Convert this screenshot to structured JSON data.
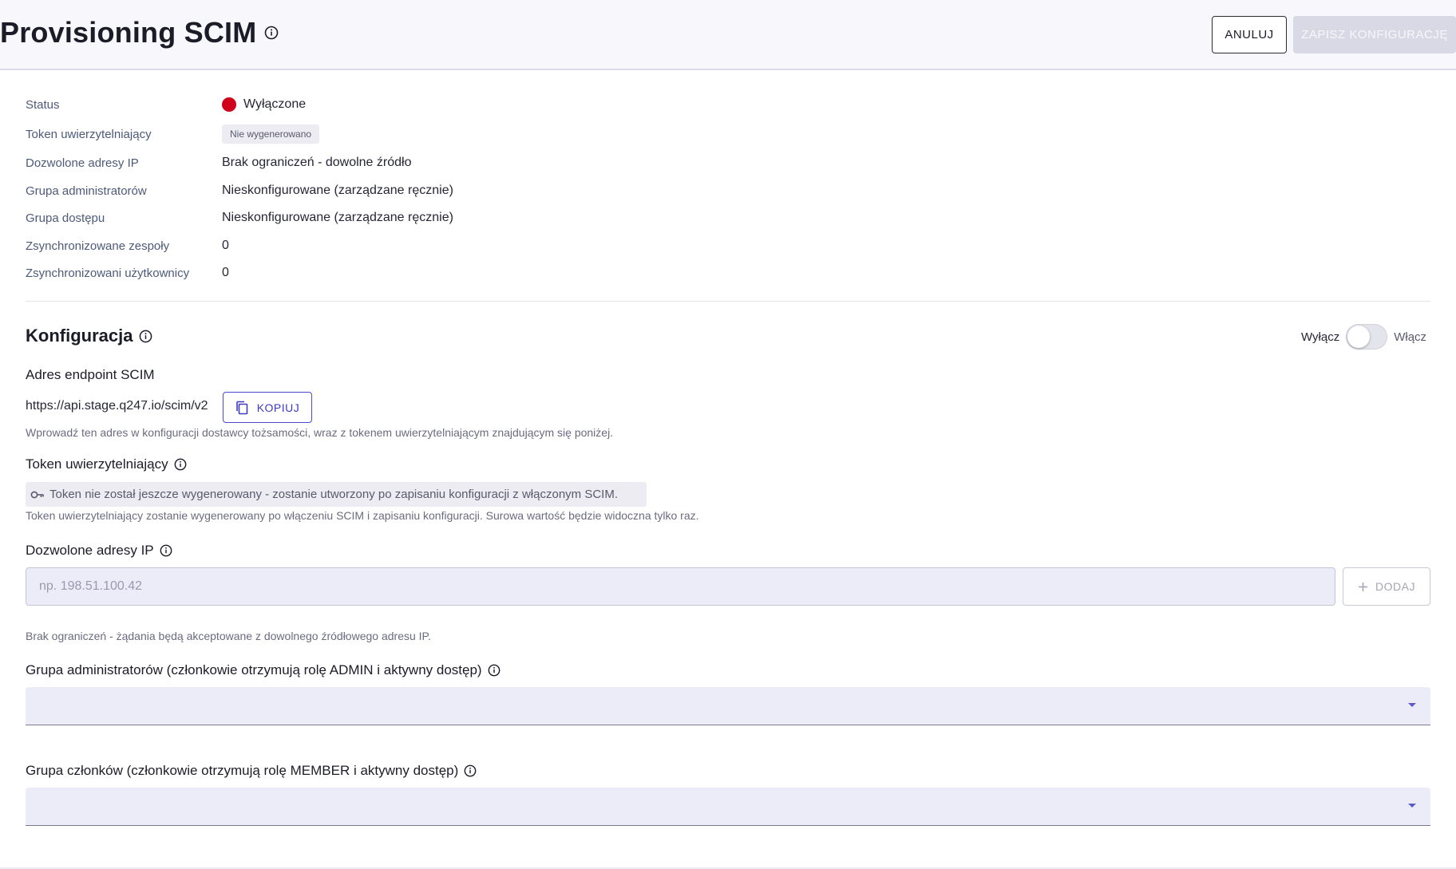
{
  "header": {
    "title": "Provisioning SCIM",
    "cancel_label": "ANULUJ",
    "save_label": "ZAPISZ KONFIGURACJĘ"
  },
  "summary": {
    "status": {
      "label": "Status",
      "value": "Wyłączone",
      "dot_color": "#d0021b"
    },
    "token": {
      "label": "Token uwierzytelniający",
      "value": "Nie wygenerowano"
    },
    "allowed_ips": {
      "label": "Dozwolone adresy IP",
      "value": "Brak ograniczeń - dowolne źródło"
    },
    "admin_group": {
      "label": "Grupa administratorów",
      "value": "Nieskonfigurowane (zarządzane ręcznie)"
    },
    "access_group": {
      "label": "Grupa dostępu",
      "value": "Nieskonfigurowane (zarządzane ręcznie)"
    },
    "synced_teams": {
      "label": "Zsynchronizowane zespoły",
      "value": "0"
    },
    "synced_users": {
      "label": "Zsynchronizowani użytkownicy",
      "value": "0"
    }
  },
  "config": {
    "title": "Konfiguracja",
    "toggle_off_label": "Wyłącz",
    "toggle_on_label": "Włącz",
    "toggle_enabled": false,
    "endpoint": {
      "label": "Adres endpoint SCIM",
      "url": "https://api.stage.q247.io/scim/v2",
      "copy_label": "KOPIUJ",
      "helper": "Wprowadź ten adres w konfiguracji dostawcy tożsamości, wraz z tokenem uwierzytelniającym znajdującym się poniżej."
    },
    "token": {
      "label": "Token uwierzytelniający",
      "placeholder_text": "Token nie został jeszcze wygenerowany - zostanie utworzony po zapisaniu konfiguracji z włączonym SCIM.",
      "helper": "Token uwierzytelniający zostanie wygenerowany po włączeniu SCIM i zapisaniu konfiguracji. Surowa wartość będzie widoczna tylko raz."
    },
    "allowed_ips": {
      "label": "Dozwolone adresy IP",
      "input_value": "",
      "input_placeholder": "np. 198.51.100.42",
      "add_label": "DODAJ",
      "helper": "Brak ograniczeń - żądania będą akceptowane z dowolnego źródłowego adresu IP."
    },
    "admin_group": {
      "label": "Grupa administratorów (członkowie otrzymują rolę ADMIN i aktywny dostęp)",
      "selected": ""
    },
    "member_group": {
      "label": "Grupa członków (członkowie otrzymują rolę MEMBER i aktywny dostęp)",
      "selected": ""
    }
  },
  "icons": {
    "info": "info-circle-icon",
    "copy": "copy-icon",
    "key": "key-icon",
    "plus": "plus-icon",
    "caret": "caret-down-icon"
  },
  "colors": {
    "accent": "#3b3bc4",
    "status_off": "#d0021b",
    "disabled_button": "#d9d9e6"
  }
}
